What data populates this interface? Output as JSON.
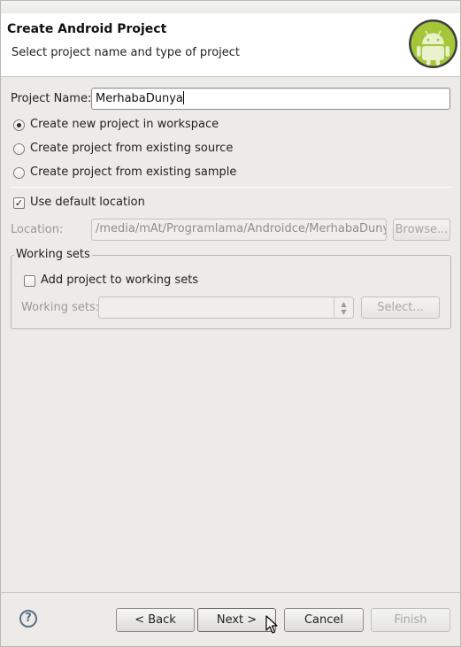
{
  "dialog": {
    "title": "Create Android Project",
    "description": "Select project name and type of project"
  },
  "project_name": {
    "label": "Project Name:",
    "value": "MerhabaDunya"
  },
  "project_options": [
    {
      "label": "Create new project in workspace",
      "selected": true
    },
    {
      "label": "Create project from existing source",
      "selected": false
    },
    {
      "label": "Create project from existing sample",
      "selected": false
    }
  ],
  "location": {
    "use_default_label": "Use default location",
    "use_default_checked": true,
    "label": "Location:",
    "value": "/media/mAt/Programlama/Androidce/MerhabaDunya",
    "browse_label": "Browse..."
  },
  "working_sets": {
    "group_title": "Working sets",
    "add_label": "Add project to working sets",
    "field_label": "Working sets:",
    "select_label": "Select..."
  },
  "footer": {
    "help_glyph": "?",
    "back_label": "< Back",
    "next_label": "Next >",
    "cancel_label": "Cancel",
    "finish_label": "Finish"
  },
  "icons": {
    "logo": "android-logo-icon",
    "help": "help-icon",
    "cursor": "mouse-pointer-icon"
  },
  "colors": {
    "android_green": "#a4c639",
    "header_bg": "#ffffff",
    "window_bg": "#ecebe8"
  }
}
